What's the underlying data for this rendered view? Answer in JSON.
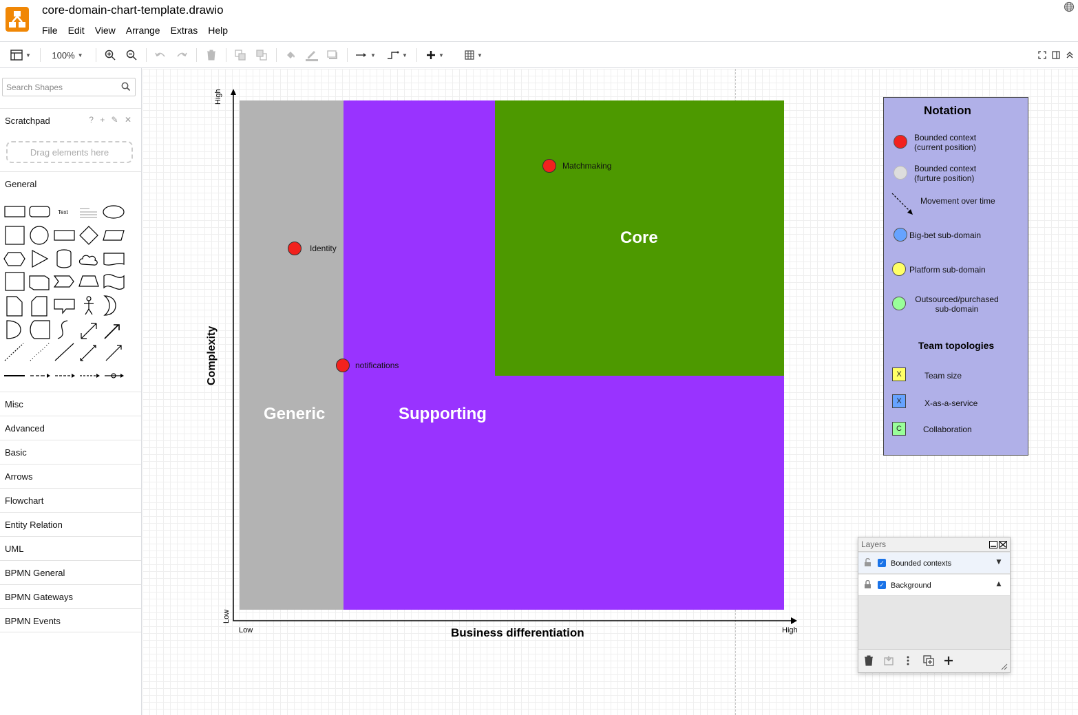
{
  "app": {
    "title": "core-domain-chart-template.drawio",
    "menu": [
      "File",
      "Edit",
      "View",
      "Arrange",
      "Extras",
      "Help"
    ]
  },
  "toolbar": {
    "zoom": "100%"
  },
  "sidebar": {
    "search_placeholder": "Search Shapes",
    "scratchpad": "Scratchpad",
    "scratchpad_tools": "? + ✎ ✕",
    "dropzone": "Drag elements here",
    "general": "General",
    "text_shape": "Text",
    "sections": [
      "Misc",
      "Advanced",
      "Basic",
      "Arrows",
      "Flowchart",
      "Entity Relation",
      "UML",
      "BPMN General",
      "BPMN Gateways",
      "BPMN Events"
    ]
  },
  "diagram": {
    "zones": {
      "generic": "Generic",
      "supporting": "Supporting",
      "core": "Core"
    },
    "zone_colors": {
      "generic": "#b3b3b3",
      "supporting": "#9933ff",
      "core": "#4d9900"
    },
    "axes": {
      "y_label": "Complexity",
      "y_high": "High",
      "y_low": "Low",
      "x_label": "Business differentiation",
      "x_low": "Low",
      "x_high": "High"
    },
    "contexts": [
      {
        "name": "Matchmaking"
      },
      {
        "name": "Identity"
      },
      {
        "name": "notifications"
      }
    ]
  },
  "notation": {
    "title": "Notation",
    "items": [
      {
        "line1": "Bounded context",
        "line2": "(current position)",
        "color": "#f2221e"
      },
      {
        "line1": "Bounded context",
        "line2": "(furture position)",
        "color": "#dddddd"
      },
      {
        "line1": "Movement over time"
      },
      {
        "line1": "Big-bet sub-domain",
        "color": "#66a3ff"
      },
      {
        "line1": "Platform sub-domain",
        "color": "#ffff66"
      },
      {
        "line1": "Outsourced/purchased",
        "line2": "sub-domain",
        "color": "#99ff99"
      }
    ],
    "team_title": "Team topologies",
    "team": [
      {
        "mark": "X",
        "label": "Team size",
        "color": "#ffff66"
      },
      {
        "mark": "X",
        "label": "X-as-a-service",
        "color": "#66a3ff"
      },
      {
        "mark": "C",
        "label": "Collaboration",
        "color": "#99ff99"
      }
    ]
  },
  "layers": {
    "title": "Layers",
    "rows": [
      {
        "name": "Bounded contexts",
        "arrow": "▼"
      },
      {
        "name": "Background",
        "arrow": "▲"
      }
    ]
  }
}
